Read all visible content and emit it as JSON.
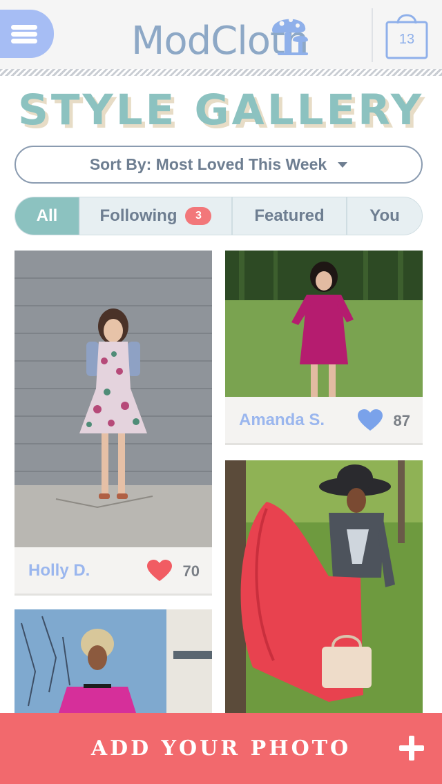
{
  "header": {
    "logo_text": "ModCloth",
    "bag_count": "13",
    "menu_icon": "hamburger-menu-icon",
    "bag_icon": "shopping-bag-icon",
    "logo_icon": "mushroom-logo-icon"
  },
  "page": {
    "title": "STYLE GALLERY"
  },
  "sort": {
    "label": "Sort By: Most Loved This Week",
    "icon": "chevron-down-icon"
  },
  "tabs": [
    {
      "label": "All",
      "active": true
    },
    {
      "label": "Following",
      "badge": "3"
    },
    {
      "label": "Featured"
    },
    {
      "label": "You"
    }
  ],
  "gallery": [
    {
      "author": "Holly D.",
      "likes": "70",
      "liked": true
    },
    {
      "author": "Amanda S.",
      "likes": "87",
      "liked": false
    },
    {
      "author": "",
      "likes": ""
    },
    {
      "author": "",
      "likes": ""
    }
  ],
  "add_photo": {
    "label": "ADD YOUR PHOTO",
    "icon": "plus-icon"
  },
  "colors": {
    "accent_teal": "#8cc2c0",
    "menu_blue": "#a6bdf4",
    "cta_red": "#f2696d",
    "heart_red": "#f15c63",
    "heart_blue": "#7aa2ea",
    "author_blue": "#9ab6ee"
  }
}
